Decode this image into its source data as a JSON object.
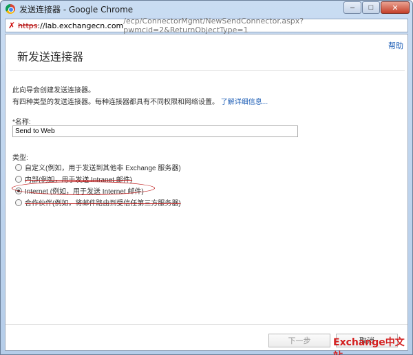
{
  "window": {
    "title": "发送连接器 - Google Chrome",
    "minimize": "–",
    "maximize": "□",
    "close": "✕"
  },
  "address": {
    "protocol": "https",
    "host": "://lab.exchangecn.com",
    "path": "/ecp/ConnectorMgmt/NewSendConnector.aspx?pwmcid=2&ReturnObjectType=1"
  },
  "page": {
    "title": "新发送连接器",
    "help": "帮助",
    "intro_line1": "此向导会创建发送连接器。",
    "intro_line2": "有四种类型的发送连接器。每种连接器都具有不同权限和网络设置。",
    "more_info": "了解详细信息..."
  },
  "form": {
    "name_label": "*名称:",
    "name_value": "Send to Web",
    "type_label": "类型:",
    "types": [
      {
        "label": "自定义(例如，用于发送到其他非 Exchange 服务器)",
        "checked": false
      },
      {
        "label": "内部(例如，用于发送 Intranet 邮件)",
        "checked": false
      },
      {
        "label": "Internet (例如，用于发送 Internet 邮件)",
        "checked": true
      },
      {
        "label": "合作伙伴(例如，将邮件路由到受信任第三方服务器)",
        "checked": false
      }
    ]
  },
  "buttons": {
    "next": "下一步",
    "cancel": "取消"
  },
  "watermark": "Exchange中文站",
  "colors": {
    "link": "#1b5cb5",
    "annotation": "#c02020"
  }
}
